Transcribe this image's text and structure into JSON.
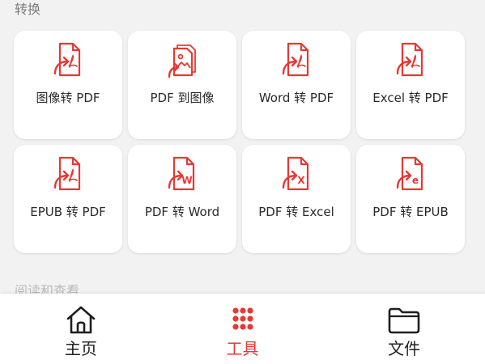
{
  "sections": {
    "convert_title": "转换",
    "next_title": "阅读和查看"
  },
  "tools": [
    {
      "label": "图像转 PDF",
      "icon": "file-convert-pdf-icon"
    },
    {
      "label": "PDF 到图像",
      "icon": "image-file-convert-icon"
    },
    {
      "label": "Word 转 PDF",
      "icon": "file-convert-pdf-icon"
    },
    {
      "label": "Excel 转 PDF",
      "icon": "file-convert-pdf-icon"
    },
    {
      "label": "EPUB 转 PDF",
      "icon": "file-convert-pdf-icon"
    },
    {
      "label": "PDF 转 Word",
      "icon": "file-convert-word-icon",
      "badge": "W"
    },
    {
      "label": "PDF 转 Excel",
      "icon": "file-convert-excel-icon",
      "badge": "X"
    },
    {
      "label": "PDF 转 EPUB",
      "icon": "file-convert-epub-icon",
      "badge": "e"
    }
  ],
  "nav": [
    {
      "label": "主页",
      "icon": "home-icon",
      "active": false
    },
    {
      "label": "工具",
      "icon": "tools-grid-icon",
      "active": true
    },
    {
      "label": "文件",
      "icon": "folder-icon",
      "active": false
    }
  ],
  "colors": {
    "accent": "#e53935",
    "background": "#f2f2f2",
    "card": "#ffffff"
  }
}
